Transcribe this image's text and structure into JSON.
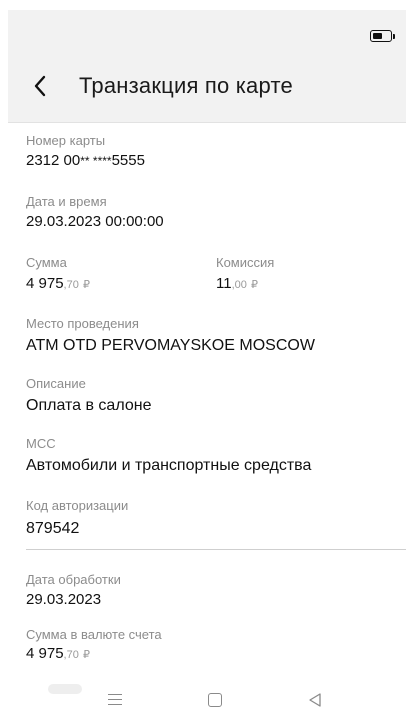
{
  "header": {
    "title": "Транзакция по карте"
  },
  "fields": {
    "card_number": {
      "label": "Номер карты",
      "prefix": "2312 00",
      "mask": "** ****",
      "suffix": "5555"
    },
    "datetime": {
      "label": "Дата и время",
      "value": "29.03.2023 00:00:00"
    },
    "amount": {
      "label": "Сумма",
      "main": "4 975",
      "fraction": ",70",
      "currency": "₽"
    },
    "commission": {
      "label": "Комиссия",
      "main": "11",
      "fraction": ",00",
      "currency": "₽"
    },
    "place": {
      "label": "Место проведения",
      "value": "ATM OTD PERVOMAYSKOE MOSCOW"
    },
    "description": {
      "label": "Описание",
      "value": "Оплата в салоне"
    },
    "mcc": {
      "label": "MCC",
      "value": "Автомобили и транспортные средства"
    },
    "auth_code": {
      "label": "Код авторизации",
      "value": "879542"
    },
    "processing_date": {
      "label": "Дата обработки",
      "value": "29.03.2023"
    },
    "account_amount": {
      "label": "Сумма в валюте счета",
      "main": "4 975",
      "fraction": ",70",
      "currency": "₽"
    }
  },
  "icons": {
    "battery": "battery-icon",
    "back": "chevron-left-icon",
    "menu": "menu-icon",
    "home": "home-square-icon",
    "nav_back": "triangle-back-icon"
  }
}
